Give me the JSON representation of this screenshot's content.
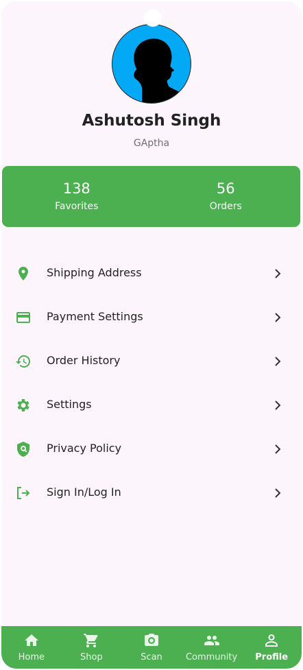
{
  "profile": {
    "name": "Ashutosh Singh",
    "username": "GAptha"
  },
  "stats": [
    {
      "value": "138",
      "label": "Favorites"
    },
    {
      "value": "56",
      "label": "Orders"
    }
  ],
  "menu": [
    {
      "label": "Shipping Address",
      "icon": "location-pin-icon"
    },
    {
      "label": "Payment Settings",
      "icon": "credit-card-icon"
    },
    {
      "label": "Order History",
      "icon": "history-icon"
    },
    {
      "label": "Settings",
      "icon": "gear-icon"
    },
    {
      "label": "Privacy Policy",
      "icon": "shield-icon"
    },
    {
      "label": "Sign In/Log In",
      "icon": "login-icon"
    }
  ],
  "bottom_nav": {
    "items": [
      {
        "label": "Home",
        "icon": "home-icon"
      },
      {
        "label": "Shop",
        "icon": "cart-icon"
      },
      {
        "label": "Scan",
        "icon": "camera-icon"
      },
      {
        "label": "Community",
        "icon": "people-icon"
      },
      {
        "label": "Profile",
        "icon": "person-icon"
      }
    ],
    "active": "Profile"
  },
  "colors": {
    "accent": "#4caf50",
    "avatar_bg": "#03a9f4",
    "background": "#fcf5fb"
  }
}
